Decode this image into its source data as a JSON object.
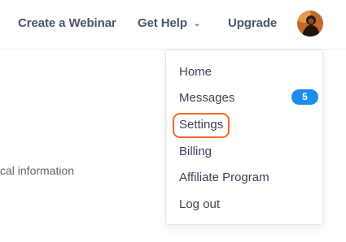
{
  "header": {
    "create_webinar": "Create a Webinar",
    "get_help": "Get Help",
    "upgrade": "Upgrade",
    "chevron_icon": "chevron-down-icon"
  },
  "background": {
    "partial_text": "cal information"
  },
  "menu": {
    "items": [
      {
        "label": "Home"
      },
      {
        "label": "Messages",
        "badge": "5"
      },
      {
        "label": "Settings",
        "highlighted": true
      },
      {
        "label": "Billing"
      },
      {
        "label": "Affiliate Program"
      },
      {
        "label": "Log out"
      }
    ]
  },
  "colors": {
    "badge": "#1d8cf0",
    "highlight": "#f06b2d"
  }
}
